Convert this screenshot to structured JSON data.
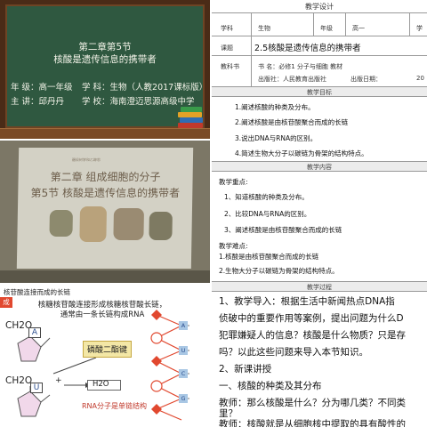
{
  "board": {
    "title_line1": "第二章第5节",
    "title_line2": "核酸是遗传信息的携带者",
    "grade_label": "年     级：高一年级",
    "subject_label": "学     科：生物（人教2017课标版）",
    "teacher_label": "主     讲：邱丹丹",
    "school_label": "学     校：海南澄迈思源高级中学"
  },
  "photo": {
    "chapter": "第二章    组成细胞的分子",
    "section": "第5节    核酸是遗传信息的携带者",
    "tiny_label": "疆段树学和乙醇思"
  },
  "slide": {
    "caption": "核苷酸连接而成的长链",
    "red_tag": "成",
    "note_line1": "核糖核苷酸连接形成核糖核苷酸长链，",
    "note_line2": "通常由一条长链构成RNA",
    "ch2oh_top": "CH2O",
    "ch2oh_bottom": "CH2O",
    "base_a": "A",
    "base_u": "U",
    "link_label": "磷酸二酯键",
    "plus": "+",
    "h2o": "H2O",
    "h2o_arrow": "→",
    "rna_note": "RNA分子是单链结构",
    "chain_bases": [
      "A",
      "U",
      "C",
      "G"
    ]
  },
  "doc": {
    "title": "教学设计",
    "row1": {
      "subject_label": "学科",
      "subject_value": "生物",
      "grade_label": "年级",
      "grade_value": "高一",
      "term_label": "学"
    },
    "row2": {
      "lesson_label": "课题",
      "lesson_value": "2.5核酸是遗传信息的携带者"
    },
    "row3": {
      "book_label": "教科书",
      "name_label": "书    名：必修1 分子与细胞 教材",
      "publisher_label": "出版社：人民教育出版社",
      "date_label": "出版日期：",
      "date_value": "20"
    },
    "goals_header": "教学目标",
    "goals": [
      "1.阐述核酸的种类及分布。",
      "2.阐述核酸是由核苷酸聚合而成的长链",
      "3.说出DNA与RNA的区别。",
      "4.简述生物大分子以碳链为骨架的结构特点。"
    ],
    "content_header": "教学内容",
    "key_title": "教学重点:",
    "key_points": [
      "1、知道核酸的种类及分布。",
      "2、比较DNA与RNA的区别。",
      "3、阐述核酸是由核苷酸聚合而成的长链"
    ],
    "difficulty_title": "教学难点:",
    "difficulty_points": [
      "1.核酸是由核苷酸聚合而成的长链",
      "2.生物大分子以碳链为骨架的结构特点。"
    ],
    "process_header": "教学过程",
    "process_lines": [
      "    1、教学导入：根据生活中新闻热点DNA指",
      "侦破中的重要作用等案例，提出问题为什么D",
      "犯罪嫌疑人的信息？核酸是什么物质？只是存",
      "吗？以此这些问题来导入本节知识。",
      "    2、新课讲授",
      "  一、核酸的种类及其分布",
      "    教师：那么核酸是什么？分为哪几类？不同类",
      "里？",
      "    教师：核酸就是从细胞核中提取的具有酸性的"
    ]
  }
}
